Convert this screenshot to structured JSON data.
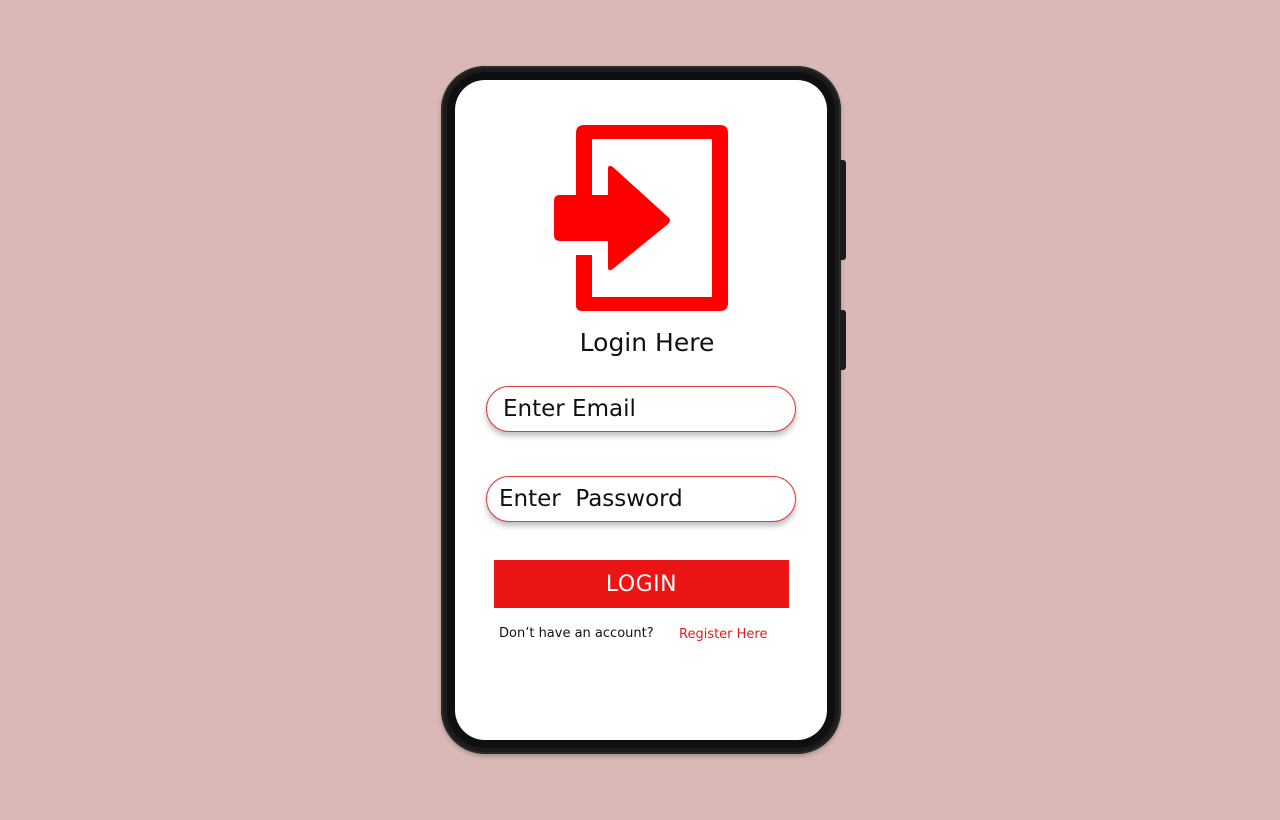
{
  "screen": {
    "title": "Login Here",
    "icon": "login-door-arrow-icon",
    "email_placeholder": "Enter Email",
    "password_placeholder": "Enter  Password",
    "login_label": "LOGIN",
    "footer_prompt": "Don’t have an account?",
    "register_link": "Register Here"
  },
  "colors": {
    "background": "#d9b8b6",
    "accent": "#ec1515",
    "field_border": "#e23a3a",
    "link": "#e02020",
    "phone_frame": "#1b1b1b"
  }
}
